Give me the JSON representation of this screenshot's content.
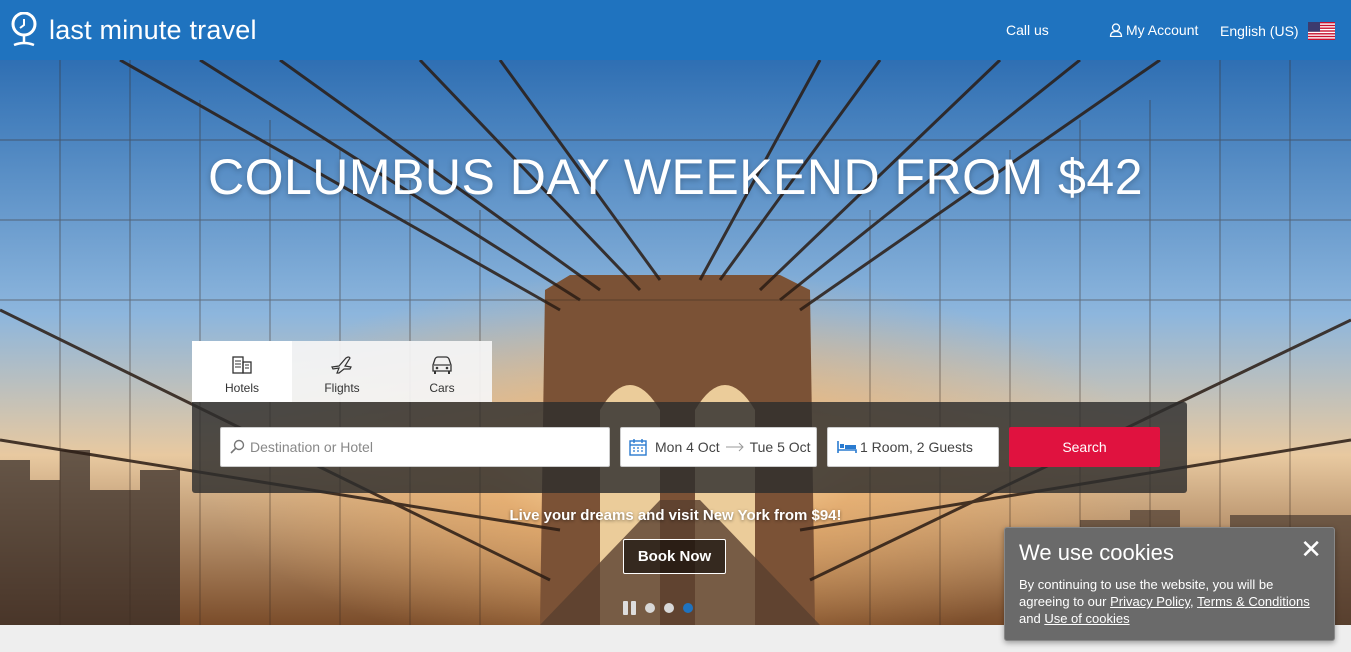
{
  "brand": {
    "name": "last minute travel",
    "color": "#1f73bf"
  },
  "nav": {
    "call_us": "Call us",
    "my_account": "My Account",
    "language": "English (US)",
    "account_icon": "user-icon",
    "flag_icon": "us-flag-icon"
  },
  "hero": {
    "title": "COLUMBUS DAY WEEKEND FROM $42",
    "promo": "Live your dreams and visit New York from $94!",
    "book_now": "Book Now"
  },
  "search": {
    "tabs": [
      {
        "label": "Hotels",
        "icon": "hotel-icon",
        "active": true
      },
      {
        "label": "Flights",
        "icon": "plane-icon",
        "active": false
      },
      {
        "label": "Cars",
        "icon": "car-icon",
        "active": false
      }
    ],
    "destination_placeholder": "Destination or Hotel",
    "checkin": "Mon 4 Oct",
    "checkout": "Tue 5 Oct",
    "rooms": "1 Room, 2 Guests",
    "search_label": "Search",
    "search_color": "#e0123f"
  },
  "carousel": {
    "slides": 3,
    "active_index": 2
  },
  "cookies": {
    "title": "We use cookies",
    "text_before": "By continuing to use the website, you will be agreeing to our ",
    "privacy_link": "Privacy Policy",
    "comma": ", ",
    "terms_link": "Terms & Conditions",
    "and": " and ",
    "cookies_link": "Use of cookies"
  }
}
